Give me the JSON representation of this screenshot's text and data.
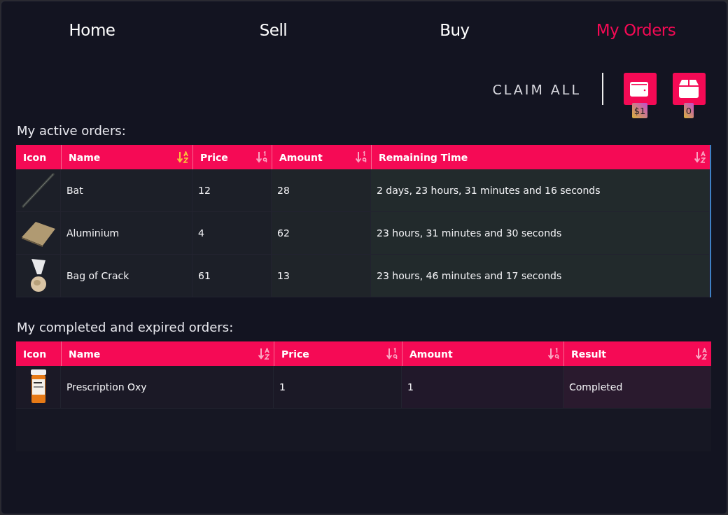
{
  "tabs": [
    {
      "label": "Home",
      "selected": false
    },
    {
      "label": "Sell",
      "selected": false
    },
    {
      "label": "Buy",
      "selected": false
    },
    {
      "label": "My Orders",
      "selected": true
    }
  ],
  "actions": {
    "claim_all": "CLAIM ALL",
    "wallet_badge": "$1",
    "package_badge": "0"
  },
  "tables": [
    {
      "title": "My active orders:",
      "columns": [
        {
          "label": "Icon",
          "kind": "plain"
        },
        {
          "label": "Name",
          "kind": "alpha",
          "selected": true
        },
        {
          "label": "Price",
          "kind": "numeric",
          "selected": false
        },
        {
          "label": "Amount",
          "kind": "numeric",
          "selected": false
        },
        {
          "label": "Remaining Time",
          "kind": "alpha",
          "selected": false
        }
      ],
      "rows": [
        {
          "kind": "bat",
          "cells": [
            "",
            "Bat",
            "12",
            "28",
            "2 days, 23 hours, 31 minutes and 16 seconds"
          ]
        },
        {
          "kind": "plate",
          "cells": [
            "",
            "Aluminium",
            "4",
            "62",
            "23 hours, 31 minutes and 30 seconds"
          ]
        },
        {
          "kind": "bag",
          "cells": [
            "",
            "Bag of Crack",
            "61",
            "13",
            "23 hours, 46 minutes and 17 seconds"
          ]
        }
      ]
    },
    {
      "title": "My completed and expired orders:",
      "columns": [
        {
          "label": "Icon",
          "kind": "plain"
        },
        {
          "label": "Name",
          "kind": "alpha",
          "selected": false
        },
        {
          "label": "Price",
          "kind": "numeric",
          "selected": false
        },
        {
          "label": "Amount",
          "kind": "numeric",
          "selected": false
        },
        {
          "label": "Result",
          "kind": "alpha",
          "selected": false
        }
      ],
      "rows": [
        {
          "kind": "bottle",
          "cells": [
            "",
            "Prescription Oxy",
            "1",
            "1",
            "Completed"
          ]
        }
      ]
    }
  ]
}
